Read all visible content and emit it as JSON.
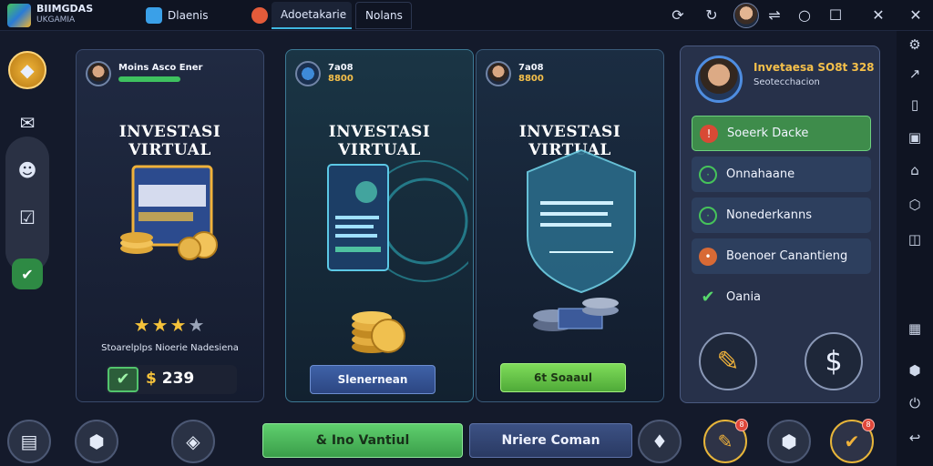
{
  "app": {
    "logo_line1": "BIIMGDAS",
    "logo_line2": "UKGAMIA"
  },
  "tabs": [
    {
      "label": "Dlaenis"
    },
    {
      "label": "Adoetakarie"
    },
    {
      "label": "Nolans"
    }
  ],
  "cards": [
    {
      "head_name": "Moins Asco Ener",
      "title": "INVESTASI VIRTUAL",
      "rating": 3,
      "rating_max": 4,
      "description": "Stoarelplps Nioerie Nadesiena",
      "price_symbol": "$",
      "price": "239"
    },
    {
      "head_line1": "7a08",
      "head_line2": "8800",
      "title": "INVESTASI VIRTUAL",
      "button_label": "Slenernean"
    },
    {
      "head_line1": "7a08",
      "head_line2": "8800",
      "title": "INVESTASI VIRTUAL",
      "button_label": "6t Soaaul"
    }
  ],
  "side_panel": {
    "title": "Invetaesa SO8t 328",
    "subtitle": "Seotecchacion",
    "items": [
      {
        "label": "Soeerk Dacke"
      },
      {
        "label": "Onnahaane"
      },
      {
        "label": "Nonederkanns"
      },
      {
        "label": "Boenoer Canantieng"
      },
      {
        "label": "Oania"
      }
    ]
  },
  "bottom": {
    "primary_label": "& Ino Vantiul",
    "secondary_label": "Nriere Coman",
    "badge_left": "8",
    "badge_right": "8"
  }
}
